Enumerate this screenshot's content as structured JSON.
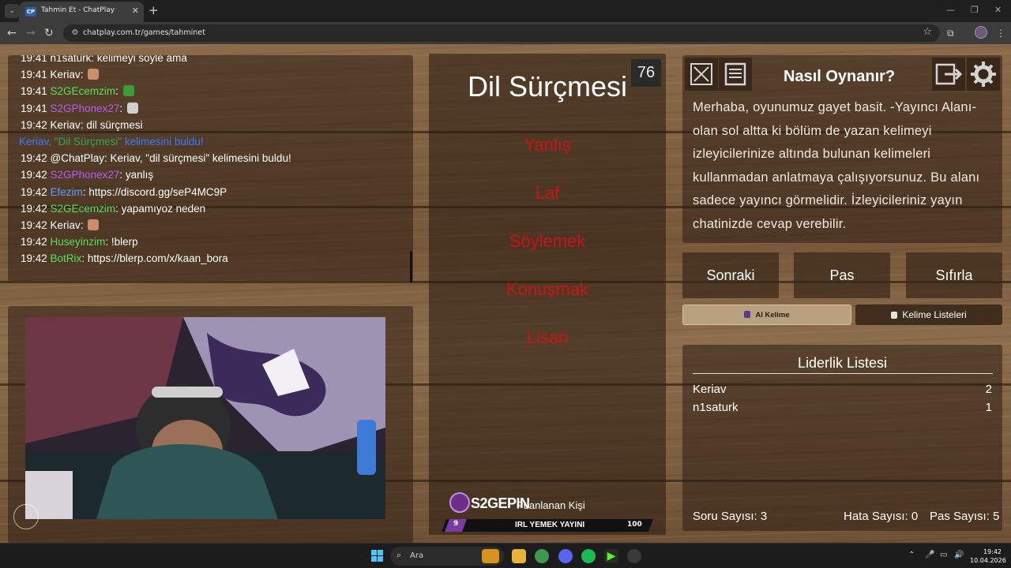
{
  "browser": {
    "tab_title": "Tahmin Et - ChatPlay",
    "tab_favicon_text": "CP",
    "url": "chatplay.com.tr/games/tahminet"
  },
  "chat": {
    "lines": [
      {
        "time": "19:41",
        "user": "n1saturk",
        "color": "#ffffff",
        "sep": ": ",
        "msg": "kelimeyi söyle ama",
        "emote": ""
      },
      {
        "time": "19:41",
        "user": "Keriav",
        "color": "#ffffff",
        "sep": ": ",
        "msg": "",
        "emote": "#c98e6a"
      },
      {
        "time": "19:41",
        "user": "S2GEcemzim",
        "color": "#54e35f",
        "sep": ": ",
        "msg": "",
        "emote": "#3f9a3a"
      },
      {
        "time": "19:41",
        "user": "S2GPhonex27",
        "color": "#b65cf0",
        "sep": ": ",
        "msg": "",
        "emote": "#cfcfcf"
      },
      {
        "time": "19:42",
        "user": "Keriav",
        "color": "#ffffff",
        "sep": ": ",
        "msg": "dil sürçmesi",
        "emote": ""
      },
      {
        "time": "",
        "user": "",
        "color": "#ffffff",
        "sep": "",
        "msg": "",
        "emote": "",
        "system": true
      },
      {
        "time": "19:42",
        "user": "@ChatPlay",
        "color": "#ffffff",
        "sep": ": ",
        "msg": "Keriav, \"dil sürçmesi\" kelimesini buldu!",
        "emote": ""
      },
      {
        "time": "19:42",
        "user": "S2GPhonex27",
        "color": "#b65cf0",
        "sep": ": ",
        "msg": "yanlış",
        "emote": ""
      },
      {
        "time": "19:42",
        "user": "Efezim",
        "color": "#5aa0ff",
        "sep": ": ",
        "msg": "https://discord.gg/seP4MC9P",
        "emote": ""
      },
      {
        "time": "19:42",
        "user": "S2GEcemzim",
        "color": "#54e35f",
        "sep": ": ",
        "msg": "yapamıyoz neden",
        "emote": ""
      },
      {
        "time": "19:42",
        "user": "Keriav",
        "color": "#ffffff",
        "sep": ": ",
        "msg": "",
        "emote": "#c98e6a"
      },
      {
        "time": "19:42",
        "user": "Huseyinzim",
        "color": "#54e35f",
        "sep": ": ",
        "msg": "!blerp",
        "emote": ""
      },
      {
        "time": "19:42",
        "user": "BotRix",
        "color": "#54e35f",
        "sep": ": ",
        "msg": "https://blerp.com/x/kaan_bora",
        "emote": ""
      }
    ],
    "system_line": {
      "name": "Keriav,",
      "word": "\"Dil Sürçmesi\"",
      "text": "kelimesini buldu!"
    }
  },
  "game": {
    "timer": "76",
    "main_word": "Dil Sürçmesi",
    "taboo_words": [
      "Yanlış",
      "Laf",
      "Söylemek",
      "Konuşmak",
      "Lisan"
    ]
  },
  "sponsor": {
    "brand": "S2GEPIN",
    "subtitle": "Puanlanan Kişi",
    "bar_left": "9",
    "bar_title": "IRL YEMEK YAYINI",
    "bar_right": "100"
  },
  "howto": {
    "title": "Nasıl Oynanır?",
    "text": "Merhaba, oyunumuz gayet basit. -Yayıncı Alanı- olan sol altta ki bölüm de yazan kelimeyi izleyicilerinize altında bulunan kelimeleri kullanmadan anlatmaya çalışıyorsunuz. Bu alanı sadece yayıncı görmelidir. İzleyicileriniz yayın chatinizde cevap verebilir."
  },
  "controls": {
    "next": "Sonraki",
    "pass": "Pas",
    "reset": "Sıfırla",
    "ai_word": "AI Kelime",
    "word_lists": "Kelime Listeleri"
  },
  "leaderboard": {
    "title": "Liderlik Listesi",
    "rows": [
      {
        "name": "Keriav",
        "score": "2"
      },
      {
        "name": "n1saturk",
        "score": "1"
      }
    ]
  },
  "stats": {
    "questions": "Soru Sayısı: 3",
    "errors": "Hata Sayısı: 0",
    "passes": "Pas Sayısı: 5"
  },
  "taskbar": {
    "search_placeholder": "Ara",
    "time": "19:42",
    "date": "10.04.2026"
  },
  "colors": {
    "taboo": "#c8141a",
    "system_name": "#3a7bff",
    "system_word": "#2fa84f",
    "accent_ai_button": "#b9a07e"
  },
  "icons": {
    "fullscreen": "fullscreen-icon",
    "notes": "notes-icon",
    "exit": "exit-icon",
    "settings": "gear-icon"
  }
}
